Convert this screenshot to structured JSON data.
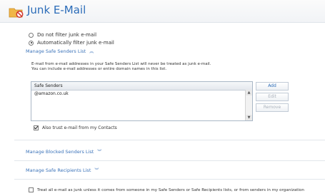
{
  "header": {
    "title": "Junk E-Mail"
  },
  "filter_options": [
    {
      "label": "Do not filter junk e-mail",
      "selected": false
    },
    {
      "label": "Automatically filter junk e-mail",
      "selected": true
    }
  ],
  "safe_senders": {
    "link_label": "Manage Safe Senders List",
    "description_line1": "E-mail from e-mail addresses in your Safe Senders List will never be treated as junk e-mail.",
    "description_line2": "You can include e-mail addresses or entire domain names in this list.",
    "list_header": "Safe Senders",
    "items": [
      "@amazon.co.uk"
    ],
    "buttons": {
      "add": "Add",
      "edit": "Edit",
      "remove": "Remove"
    },
    "trust_contacts_label": "Also trust e-mail from my Contacts",
    "trust_contacts_checked": true
  },
  "blocked_senders": {
    "link_label": "Manage Blocked Senders List"
  },
  "safe_recipients": {
    "link_label": "Manage Safe Recipients List"
  },
  "exclusive_option": {
    "label": "Treat all e-mail as junk unless it comes from someone in my Safe Senders or Safe Recipients lists, or from senders in my organization",
    "checked": false
  },
  "colors": {
    "accent": "#2b6cb8",
    "link": "#3b73b9",
    "icon_orange": "#e8a33a",
    "icon_red": "#d0342c"
  },
  "icons": {
    "header": "junk-mail-folder-icon",
    "expand": "double-chevron-up-icon",
    "collapse": "double-chevron-down-icon"
  }
}
